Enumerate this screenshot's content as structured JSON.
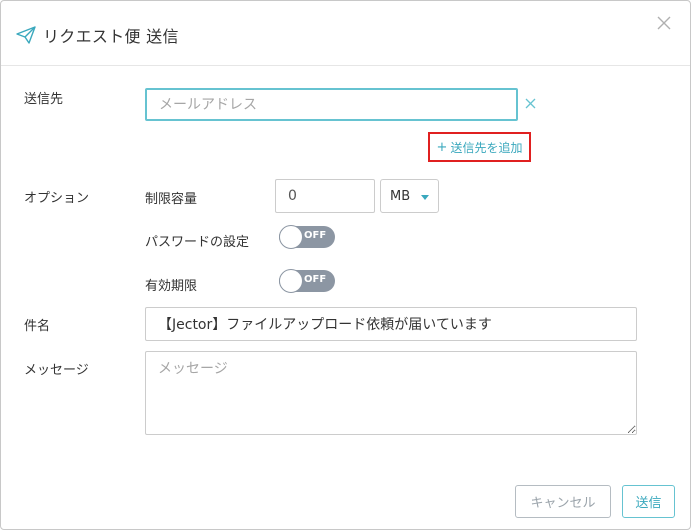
{
  "dialog": {
    "title": "リクエスト便 送信",
    "title_icon": "paper-plane-icon",
    "close_icon": "close-icon"
  },
  "recipients": {
    "label": "送信先",
    "email_placeholder": "メールアドレス",
    "email_value": "",
    "clear_icon": "clear-x-icon",
    "add_label": "送信先を追加",
    "add_icon": "plus-icon"
  },
  "options": {
    "label": "オプション",
    "capacity_label": "制限容量",
    "capacity_value": "0",
    "unit_selected": "MB",
    "password_label": "パスワードの設定",
    "password_toggle": "OFF",
    "expiry_label": "有効期限",
    "expiry_toggle": "OFF"
  },
  "subject": {
    "label": "件名",
    "value": "【Jector】ファイルアップロード依頼が届いています"
  },
  "message": {
    "label": "メッセージ",
    "placeholder": "メッセージ",
    "value": ""
  },
  "footer": {
    "cancel_label": "キャンセル",
    "send_label": "送信"
  },
  "colors": {
    "accent": "#3aa8bd",
    "highlight_border": "#e02020",
    "toggle_off": "#8c96a3"
  }
}
